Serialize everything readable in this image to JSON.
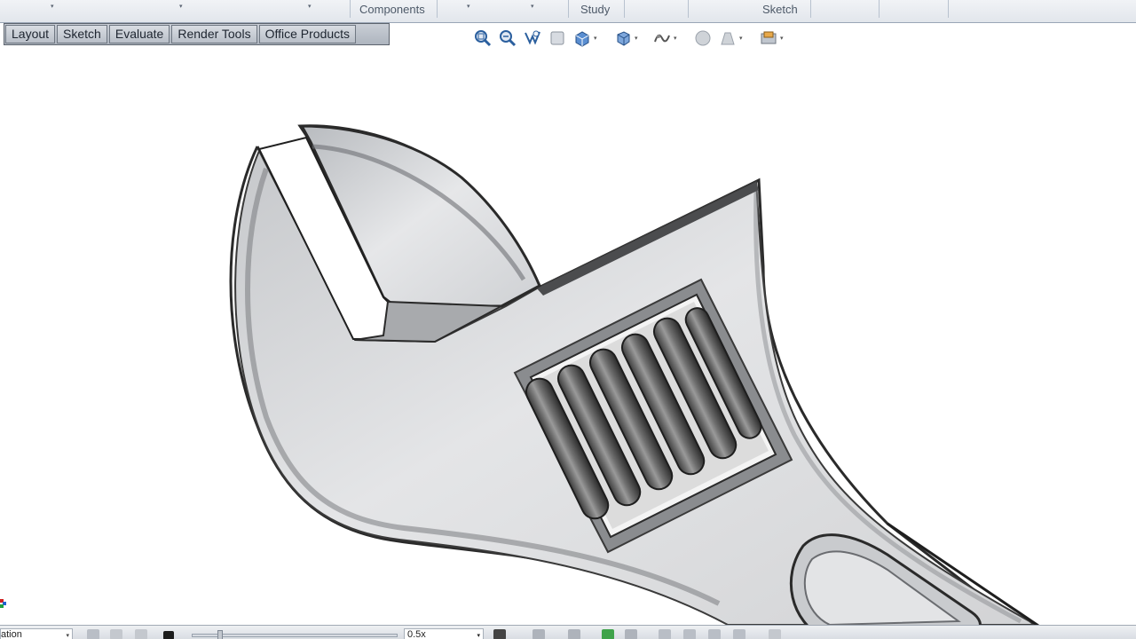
{
  "ribbon": {
    "groups": [
      "Components",
      "Study",
      "Sketch"
    ]
  },
  "command_tabs": [
    "Layout",
    "Sketch",
    "Evaluate",
    "Render Tools",
    "Office Products"
  ],
  "view_toolbar": {
    "icons": [
      "zoom-to-fit-icon",
      "zoom-to-area-icon",
      "previous-view-icon",
      "section-view-icon",
      "view-orientation-icon",
      "display-style-icon",
      "hide-show-items-icon",
      "edit-appearance-icon",
      "apply-scene-icon",
      "view-settings-icon"
    ]
  },
  "motion_bar": {
    "study_type": "ation",
    "playback_speed": "0.5x"
  },
  "colors": {
    "ribbon_bg": "#e6e9ee",
    "tab_bg": "#c4c9d1",
    "part_face": "#d6d8da",
    "part_edge": "#222222"
  }
}
